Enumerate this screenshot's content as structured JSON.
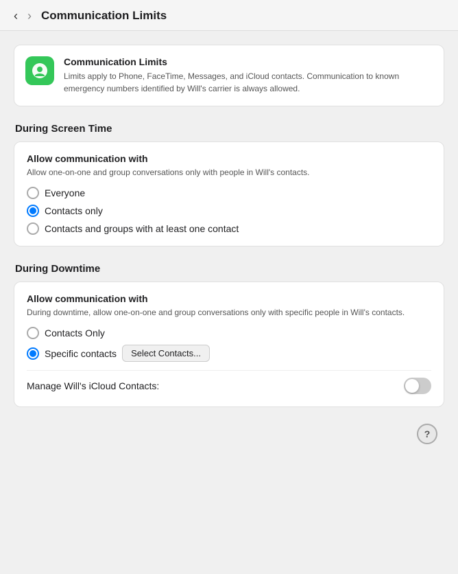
{
  "titlebar": {
    "back_label": "‹",
    "forward_label": "›",
    "title": "Communication Limits"
  },
  "info_card": {
    "icon_label": "communication-limits-icon",
    "title": "Communication Limits",
    "description": "Limits apply to Phone, FaceTime, Messages, and iCloud contacts. Communication to known emergency numbers identified by Will's carrier is always allowed."
  },
  "screen_time_section": {
    "label": "During Screen Time",
    "card_title": "Allow communication with",
    "card_desc": "Allow one-on-one and group conversations only with people in Will's contacts.",
    "options": [
      {
        "id": "everyone",
        "label": "Everyone",
        "selected": false
      },
      {
        "id": "contacts_only",
        "label": "Contacts only",
        "selected": true
      },
      {
        "id": "contacts_groups",
        "label": "Contacts and groups with at least one contact",
        "selected": false
      }
    ]
  },
  "downtime_section": {
    "label": "During Downtime",
    "card_title": "Allow communication with",
    "card_desc": "During downtime, allow one-on-one and group conversations only with specific people in Will's contacts.",
    "options": [
      {
        "id": "contacts_only_dt",
        "label": "Contacts Only",
        "selected": false
      },
      {
        "id": "specific_contacts",
        "label": "Specific contacts",
        "selected": true
      }
    ],
    "select_button_label": "Select Contacts...",
    "toggle_label": "Manage Will's iCloud Contacts:",
    "toggle_on": false
  },
  "help_button_label": "?"
}
